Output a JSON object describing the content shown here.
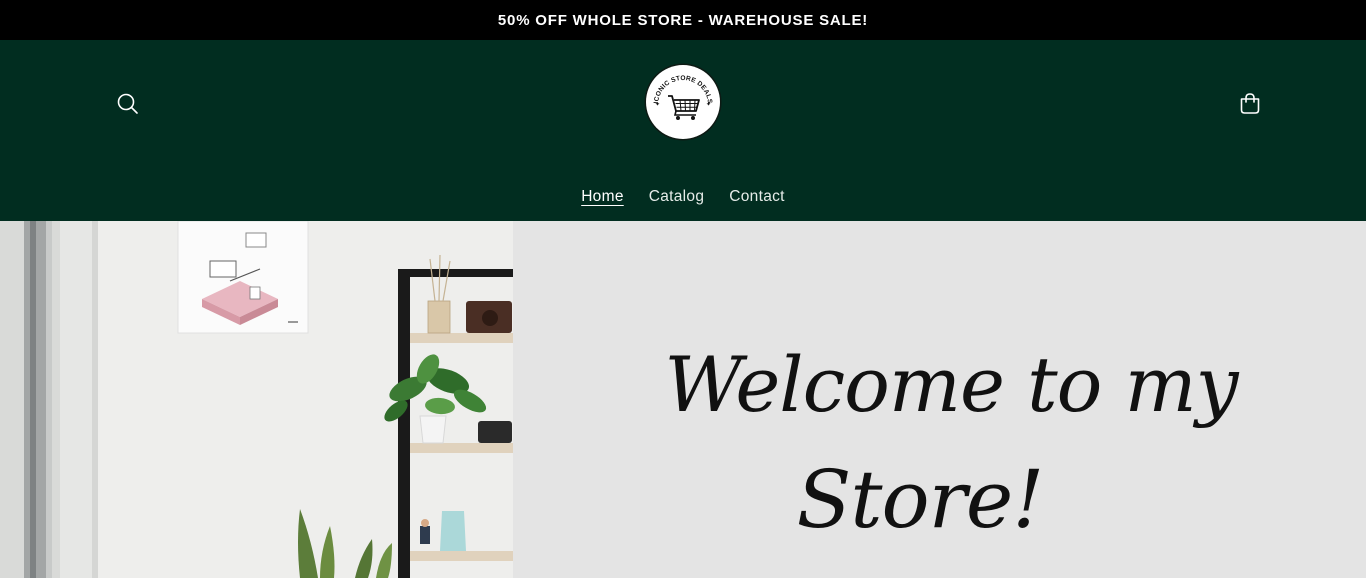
{
  "announcement": {
    "text": "50% OFF WHOLE STORE - WAREHOUSE SALE!"
  },
  "header": {
    "logo_text": "ICONIC STORE DEALS",
    "search_icon": "search-icon",
    "cart_icon": "cart-icon",
    "background": "#012d20"
  },
  "nav": {
    "items": [
      {
        "label": "Home",
        "active": true
      },
      {
        "label": "Catalog",
        "active": false
      },
      {
        "label": "Contact",
        "active": false
      }
    ]
  },
  "hero": {
    "heading_line1": "Welcome to my",
    "heading_line2": "Store!"
  },
  "colors": {
    "announcement_bg": "#000000",
    "header_bg": "#012d20",
    "hero_right_bg": "#e4e4e4"
  }
}
